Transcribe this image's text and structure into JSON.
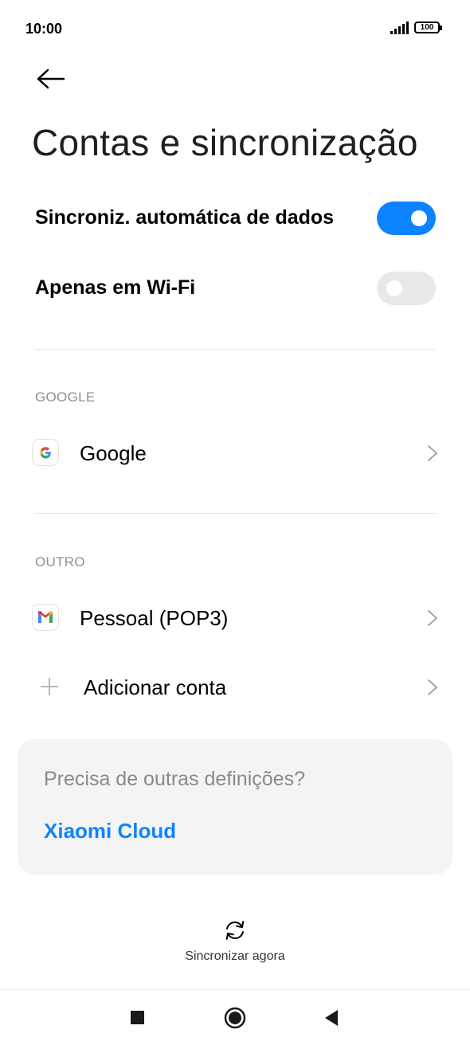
{
  "status_bar": {
    "time": "10:00",
    "battery": "100"
  },
  "header": {
    "title": "Contas e sincronização"
  },
  "settings": {
    "auto_sync_label": "Sincroniz. automática de dados",
    "auto_sync_on": true,
    "wifi_only_label": "Apenas em Wi-Fi",
    "wifi_only_on": false
  },
  "sections": {
    "google_header": "GOOGLE",
    "google_account": "Google",
    "other_header": "OUTRO",
    "pop3_account": "Pessoal (POP3)",
    "add_account": "Adicionar conta"
  },
  "card": {
    "question": "Precisa de outras definições?",
    "link": "Xiaomi Cloud"
  },
  "sync": {
    "label": "Sincronizar agora"
  },
  "colors": {
    "accent": "#0d84ff",
    "toggle_off": "#e8e8e8",
    "card_bg": "#f4f4f4"
  },
  "icons": [
    "back-arrow-icon",
    "google-icon",
    "gmail-icon",
    "plus-icon",
    "chevron-right-icon",
    "sync-icon",
    "recents-icon",
    "home-icon",
    "back-icon"
  ]
}
